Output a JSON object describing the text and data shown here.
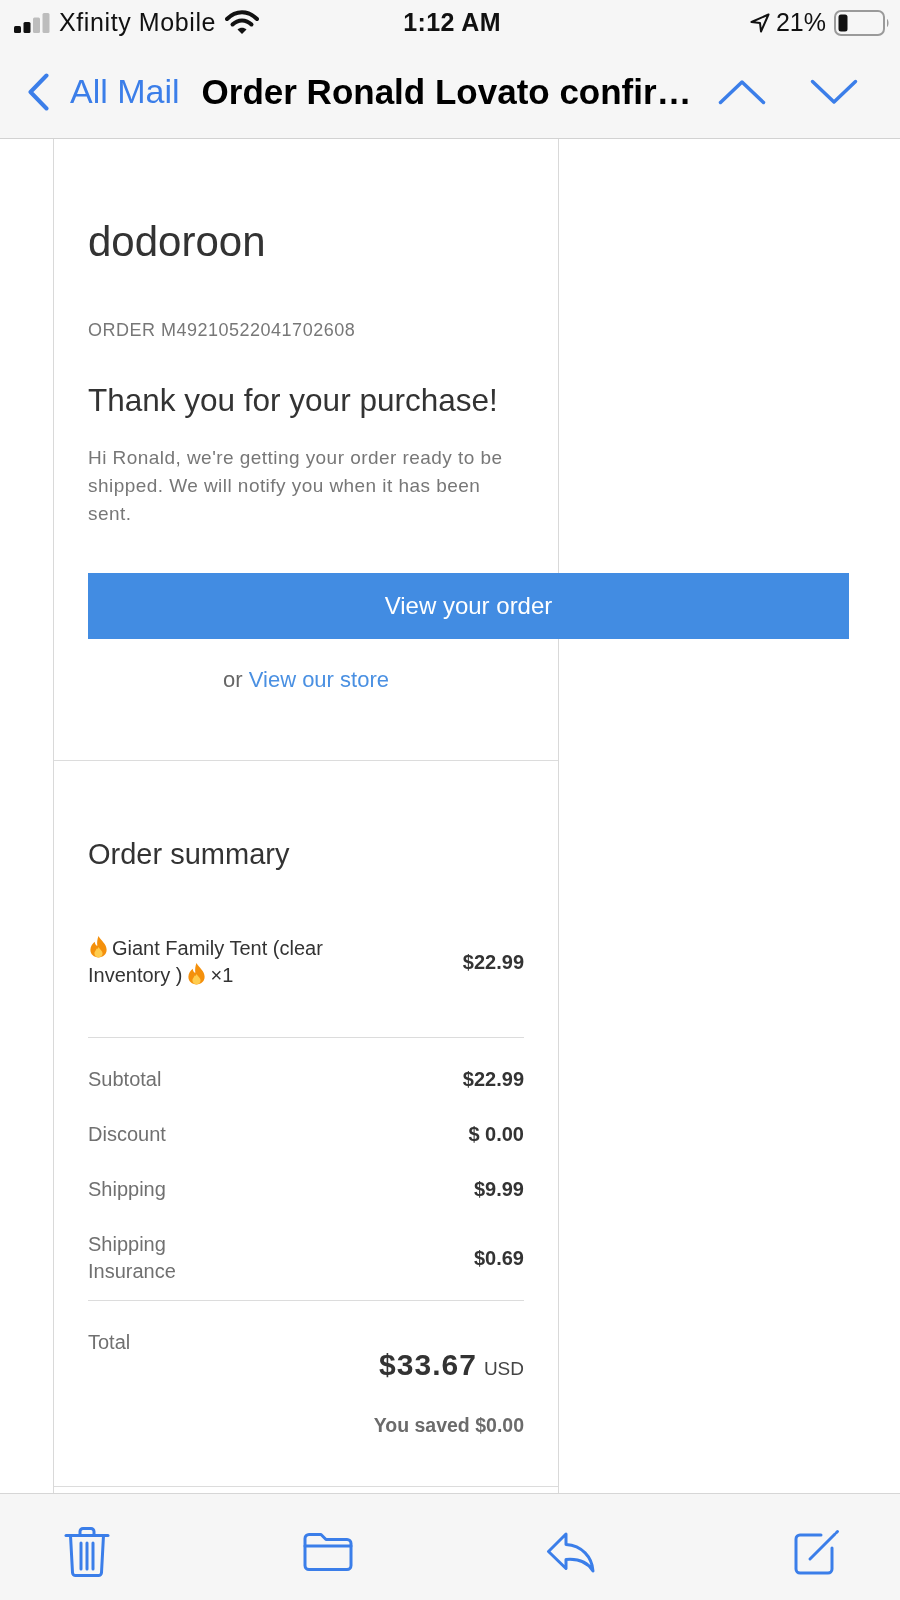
{
  "status_bar": {
    "carrier": "Xfinity Mobile",
    "time": "1:12 AM",
    "battery": "21%"
  },
  "nav_bar": {
    "back": "All Mail",
    "title": "Order Ronald Lovato confir…"
  },
  "email": {
    "store_name": "dodoroon",
    "order_number": "ORDER M49210522041702608",
    "heading": "Thank you for your purchase!",
    "message": "Hi Ronald, we're getting your order ready to be shipped. We will notify you when it has been sent.",
    "button": "View your order",
    "alt_prefix": "or",
    "alt_link": "View our store",
    "summary": {
      "title": "Order summary",
      "items": [
        {
          "name": "Giant Family Tent (clear Inventory )",
          "quantity": "×1",
          "price": "$22.99"
        }
      ],
      "lines": [
        {
          "label": "Subtotal",
          "value": "$22.99"
        },
        {
          "label": "Discount",
          "value": "$ 0.00"
        },
        {
          "label": "Shipping",
          "value": "$9.99"
        },
        {
          "label": "Shipping Insurance",
          "value": "$0.69"
        }
      ],
      "total": {
        "label": "Total",
        "amount": "$33.67",
        "currency": "USD",
        "saved": "You saved $0.00"
      }
    }
  }
}
